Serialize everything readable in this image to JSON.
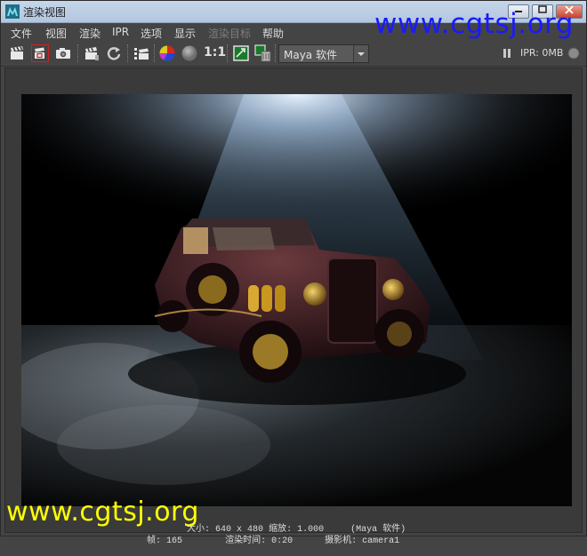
{
  "window": {
    "title": "渲染视图"
  },
  "watermarks": {
    "top": "www.cgtsj.org",
    "bottom": "www.cgtsj.org"
  },
  "menu": {
    "items": [
      {
        "label": "文件",
        "disabled": false
      },
      {
        "label": "视图",
        "disabled": false
      },
      {
        "label": "渲染",
        "disabled": false
      },
      {
        "label": "IPR",
        "disabled": false
      },
      {
        "label": "选项",
        "disabled": false
      },
      {
        "label": "显示",
        "disabled": false
      },
      {
        "label": "渲染目标",
        "disabled": true
      },
      {
        "label": "帮助",
        "disabled": false
      }
    ]
  },
  "toolbar": {
    "ratio_label": "1:1",
    "renderer_value": "Maya 软件",
    "ipr_status": "IPR: 0MB"
  },
  "render_info": {
    "size_label": "大小:",
    "size_value": "640 x 480",
    "zoom_label": "缩放:",
    "zoom_value": "1.000",
    "renderer": "(Maya 软件)",
    "frame_label": "帧:",
    "frame_value": "165",
    "time_label": "渲染时间:",
    "time_value": "0:20",
    "camera_label": "摄影机:",
    "camera_value": "camera1"
  },
  "colors": {
    "accent_red": "#d02020",
    "watermark_top": "#1a1aff",
    "watermark_bottom": "#ffff00"
  }
}
